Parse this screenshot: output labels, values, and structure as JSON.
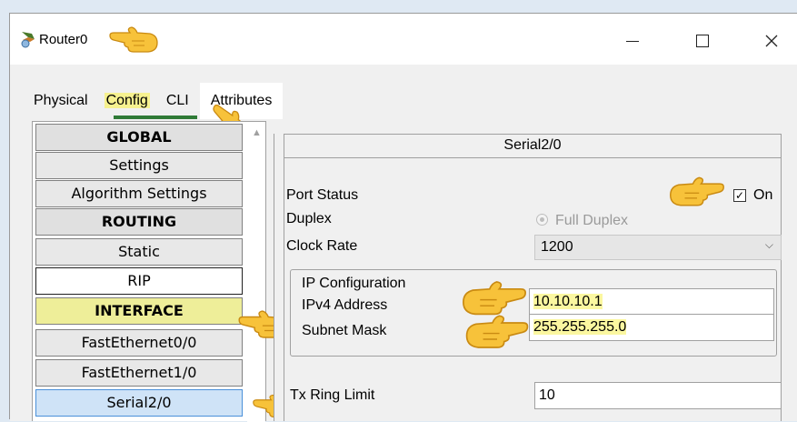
{
  "window": {
    "title": "Router0"
  },
  "tabs": [
    {
      "label": "Physical"
    },
    {
      "label": "Config"
    },
    {
      "label": "CLI"
    },
    {
      "label": "Attributes"
    }
  ],
  "sidebar": {
    "items": [
      {
        "label": "GLOBAL",
        "kind": "header"
      },
      {
        "label": "Settings",
        "kind": "item"
      },
      {
        "label": "Algorithm Settings",
        "kind": "item"
      },
      {
        "label": "ROUTING",
        "kind": "header"
      },
      {
        "label": "Static",
        "kind": "item"
      },
      {
        "label": "RIP",
        "kind": "item"
      },
      {
        "label": "INTERFACE",
        "kind": "header-highlight"
      },
      {
        "label": "FastEthernet0/0",
        "kind": "item"
      },
      {
        "label": "FastEthernet1/0",
        "kind": "item"
      },
      {
        "label": "Serial2/0",
        "kind": "selected"
      }
    ]
  },
  "panel": {
    "title": "Serial2/0",
    "port_status_label": "Port Status",
    "port_status_checked": true,
    "port_status_value": "On",
    "duplex_label": "Duplex",
    "duplex_option": "Full Duplex",
    "clock_rate_label": "Clock Rate",
    "clock_rate_value": "1200",
    "ip_config_label": "IP Configuration",
    "ipv4_label": "IPv4 Address",
    "ipv4_value": "10.10.10.1",
    "subnet_label": "Subnet Mask",
    "subnet_value": "255.255.255.0",
    "tx_ring_label": "Tx Ring Limit",
    "tx_ring_value": "10"
  },
  "colors": {
    "highlight_yellow": "#f6f18f",
    "selected_blue": "#cfe3f7",
    "tab_underline": "#2f7a36"
  }
}
